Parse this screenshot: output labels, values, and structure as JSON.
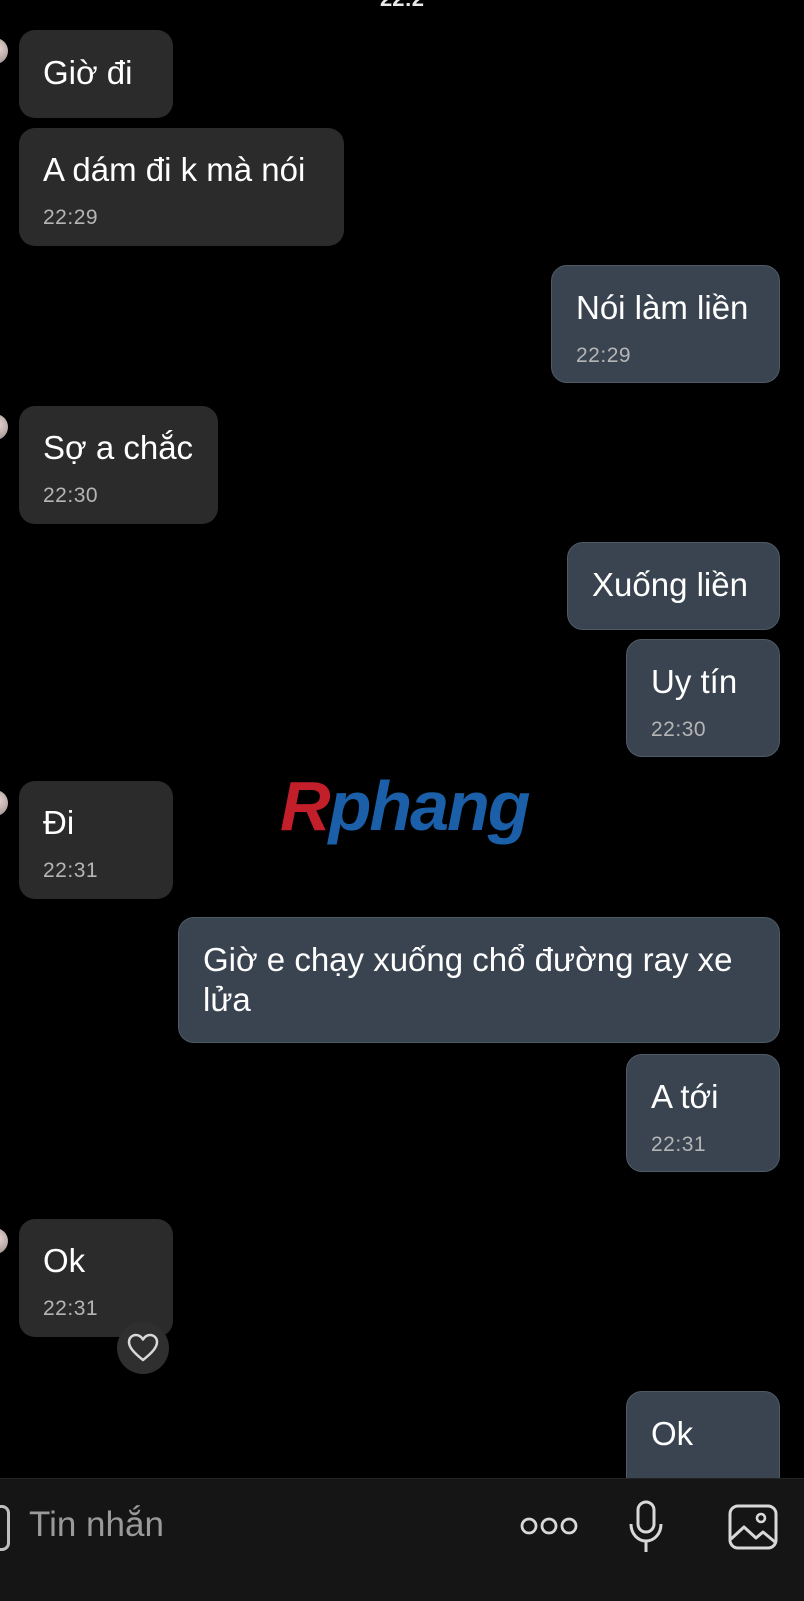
{
  "status_bar": {
    "time": "22:2"
  },
  "messages": [
    {
      "side": "in",
      "text": "Giờ đi",
      "time": ""
    },
    {
      "side": "in",
      "text": "A dám đi k mà nói",
      "time": "22:29"
    },
    {
      "side": "out",
      "text": "Nói làm liền",
      "time": "22:29"
    },
    {
      "side": "in",
      "text": "Sợ a chắc",
      "time": "22:30"
    },
    {
      "side": "out",
      "text": "Xuống liền",
      "time": ""
    },
    {
      "side": "out",
      "text": "Uy tín",
      "time": "22:30"
    },
    {
      "side": "in",
      "text": "Đi",
      "time": "22:31"
    },
    {
      "side": "out",
      "text": "Giờ e chạy xuống chổ đường ray xe lửa",
      "time": ""
    },
    {
      "side": "out",
      "text": "A tới",
      "time": "22:31"
    },
    {
      "side": "in",
      "text": "Ok",
      "time": "22:31"
    },
    {
      "side": "out",
      "text": "Ok",
      "time": ""
    }
  ],
  "watermark": {
    "first": "R",
    "rest": "phang"
  },
  "composer": {
    "placeholder": "Tin nhắn",
    "icons": [
      "more-icon",
      "microphone-icon",
      "image-icon"
    ]
  },
  "colors": {
    "background": "#000000",
    "incoming_bubble": "#2b2b2b",
    "outgoing_bubble": "#3a4450",
    "timestamp": "#b5b5b5"
  }
}
